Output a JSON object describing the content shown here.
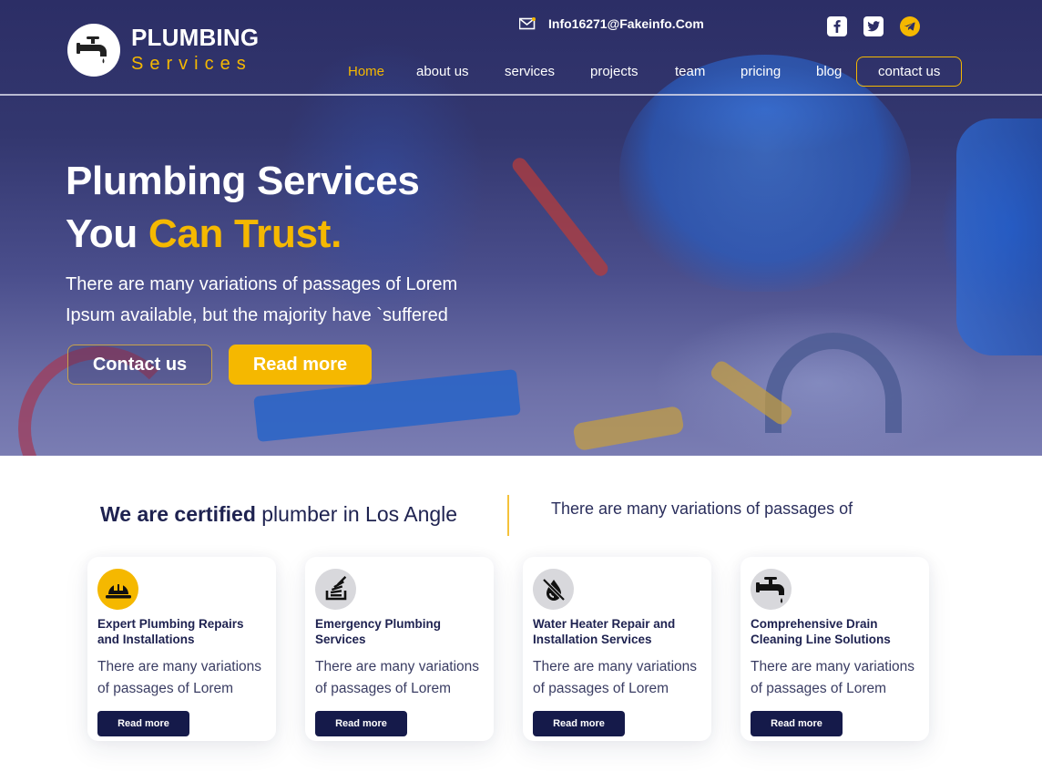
{
  "brand": {
    "title": "PLUMBING",
    "subtitle": "Services",
    "icon": "faucet-icon"
  },
  "colors": {
    "accent": "#f5b800",
    "navy": "#151a4a",
    "text_dark": "#1e2250"
  },
  "topbar": {
    "email_icon": "mail-icon",
    "email": "Info16271@Fakeinfo.Com",
    "socials": [
      {
        "name": "facebook",
        "icon": "facebook-icon"
      },
      {
        "name": "twitter",
        "icon": "twitter-icon"
      },
      {
        "name": "telegram",
        "icon": "telegram-icon"
      }
    ]
  },
  "nav": {
    "items": [
      {
        "label": "Home",
        "active": true
      },
      {
        "label": "about us"
      },
      {
        "label": "services"
      },
      {
        "label": "projects"
      },
      {
        "label": "team"
      },
      {
        "label": "pricing"
      },
      {
        "label": "blog"
      }
    ],
    "cta": "contact us"
  },
  "hero": {
    "title_line1": "Plumbing Services",
    "title_line2_plain": "You ",
    "title_line2_accent": "Can Trust.",
    "description_line1": "There are many variations of passages of Lorem",
    "description_line2": "Ipsum available, but the majority have `suffered",
    "btn_contact": "Contact us",
    "btn_read": "Read more"
  },
  "certified": {
    "bold": "We are certified",
    "rest": " plumber in Los Angle",
    "right": "There are many variations of passages of"
  },
  "services": [
    {
      "icon": "hard-hat-icon",
      "title": "Expert Plumbing Repairs and Installations",
      "desc": "There are many variations of passages of Lorem",
      "button": "Read more"
    },
    {
      "icon": "stack-icon",
      "title": "Emergency Plumbing Services",
      "desc": "There are many variations of passages of Lorem",
      "button": "Read more"
    },
    {
      "icon": "water-off-icon",
      "title": "Water Heater Repair and Installation Services",
      "desc": "There are many variations of passages of Lorem",
      "button": "Read more"
    },
    {
      "icon": "faucet-icon",
      "title": "Comprehensive Drain Cleaning Line Solutions",
      "desc": "There are many variations of passages of Lorem",
      "button": "Read more"
    }
  ]
}
